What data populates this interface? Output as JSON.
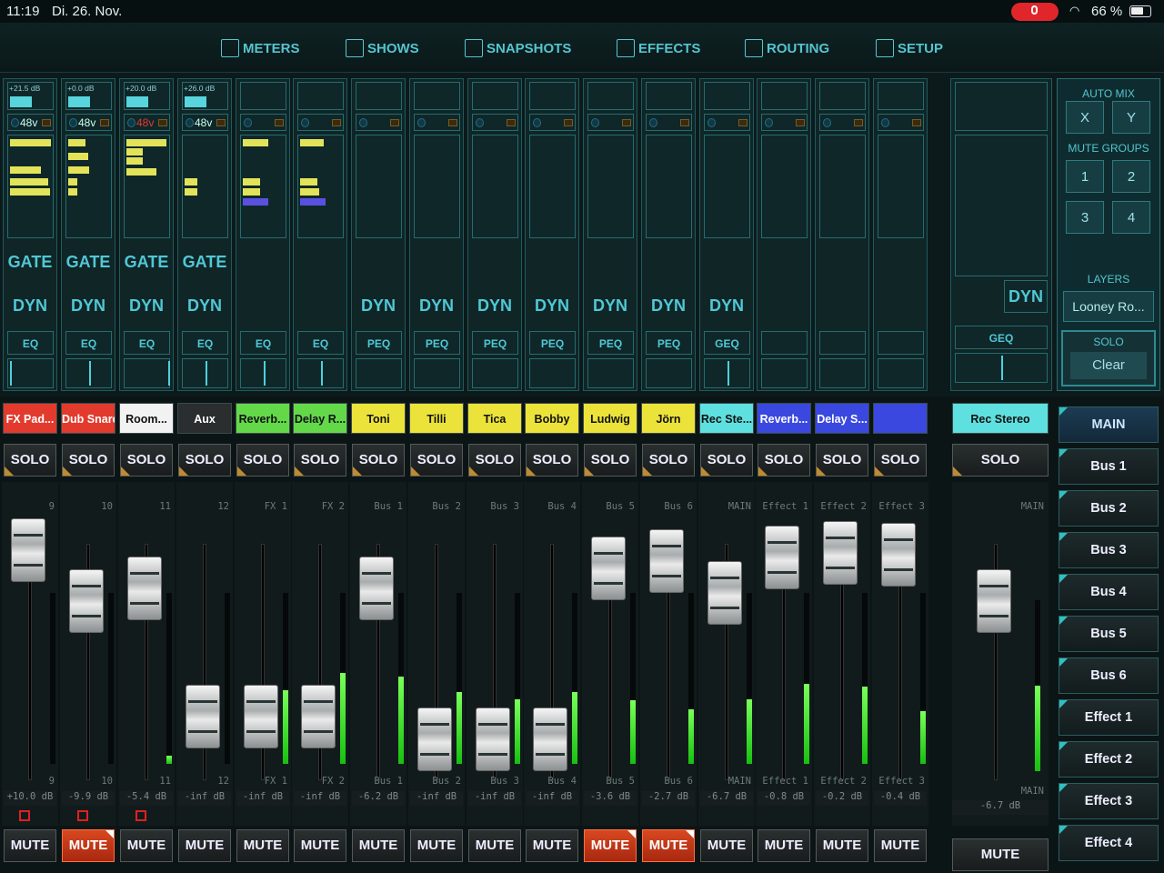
{
  "status": {
    "time": "11:19",
    "date": "Di. 26. Nov.",
    "battery": "66 %",
    "battery_level": 0.66
  },
  "nav": [
    {
      "label": "METERS",
      "icon": "meters-icon"
    },
    {
      "label": "SHOWS",
      "icon": "shows-icon"
    },
    {
      "label": "SNAPSHOTS",
      "icon": "camera-icon"
    },
    {
      "label": "EFFECTS",
      "icon": "effects-icon"
    },
    {
      "label": "ROUTING",
      "icon": "routing-icon"
    },
    {
      "label": "SETUP",
      "icon": "setup-icon"
    }
  ],
  "strips": [
    {
      "gain": "+21.5 dB",
      "phantom": "48v",
      "gate": "GATE",
      "dyn": "DYN",
      "eq": "EQ"
    },
    {
      "gain": "+0.0 dB",
      "phantom": "48v",
      "gate": "GATE",
      "dyn": "DYN",
      "eq": "EQ"
    },
    {
      "gain": "+20.0 dB",
      "phantom": "48v",
      "gate": "GATE",
      "dyn": "DYN",
      "eq": "EQ"
    },
    {
      "gain": "+26.0 dB",
      "phantom": "48v",
      "gate": "GATE",
      "dyn": "DYN",
      "eq": "EQ"
    },
    {
      "eq": "EQ"
    },
    {
      "eq": "EQ"
    },
    {
      "dyn": "DYN",
      "eq": "PEQ"
    },
    {
      "dyn": "DYN",
      "eq": "PEQ"
    },
    {
      "dyn": "DYN",
      "eq": "PEQ"
    },
    {
      "dyn": "DYN",
      "eq": "PEQ"
    },
    {
      "dyn": "DYN",
      "eq": "PEQ"
    },
    {
      "dyn": "DYN",
      "eq": "PEQ"
    },
    {
      "dyn": "DYN",
      "eq": "GEQ"
    },
    {},
    {},
    {}
  ],
  "main_strip": {
    "dyn": "DYN",
    "eq": "GEQ"
  },
  "right_panel": {
    "auto_mix": "AUTO MIX",
    "x": "X",
    "y": "Y",
    "mute_groups": "MUTE GROUPS",
    "groups": [
      "1",
      "2",
      "3",
      "4"
    ],
    "layers": "LAYERS",
    "layer": "Looney Ro...",
    "solo": "SOLO",
    "clear": "Clear"
  },
  "channels": [
    {
      "name": "FX Pad...",
      "color": "#e23b2e",
      "num": "9",
      "out": "9",
      "db": "+10.0 dB",
      "mute": false
    },
    {
      "name": "Dub Snare",
      "color": "#e23b2e",
      "num": "10",
      "out": "10",
      "db": "-9.9 dB",
      "mute": true
    },
    {
      "name": "Room...",
      "color": "#f2f2f2",
      "num": "11",
      "out": "11",
      "db": "-5.4 dB",
      "mute": false
    },
    {
      "name": "Aux",
      "color": "#2a2e2f",
      "num": "12",
      "out": "12",
      "db": "-inf dB",
      "mute": false
    },
    {
      "name": "Reverb...",
      "color": "#63d94a",
      "num": "FX 1",
      "out": "FX 1",
      "db": "-inf dB",
      "mute": false
    },
    {
      "name": "Delay R...",
      "color": "#63d94a",
      "num": "FX 2",
      "out": "FX 2",
      "db": "-inf dB",
      "mute": false
    },
    {
      "name": "Toni",
      "color": "#ece33a",
      "num": "Bus 1",
      "out": "Bus 1",
      "db": "-6.2 dB",
      "mute": false
    },
    {
      "name": "Tilli",
      "color": "#ece33a",
      "num": "Bus 2",
      "out": "Bus 2",
      "db": "-inf dB",
      "mute": false
    },
    {
      "name": "Tica",
      "color": "#ece33a",
      "num": "Bus 3",
      "out": "Bus 3",
      "db": "-inf dB",
      "mute": false
    },
    {
      "name": "Bobby",
      "color": "#ece33a",
      "num": "Bus 4",
      "out": "Bus 4",
      "db": "-inf dB",
      "mute": false
    },
    {
      "name": "Ludwig",
      "color": "#ece33a",
      "num": "Bus 5",
      "out": "Bus 5",
      "db": "-3.6 dB",
      "mute": true
    },
    {
      "name": "Jörn",
      "color": "#ece33a",
      "num": "Bus 6",
      "out": "Bus 6",
      "db": "-2.7 dB",
      "mute": true
    },
    {
      "name": "Rec Ste...",
      "color": "#5fe0e0",
      "num": "MAIN",
      "out": "MAIN",
      "db": "-6.7 dB",
      "mute": false
    },
    {
      "name": "Reverb...",
      "color": "#3a48e0",
      "num": "Effect 1",
      "out": "Effect 1",
      "db": "-0.8 dB",
      "mute": false
    },
    {
      "name": "Delay S...",
      "color": "#3a48e0",
      "num": "Effect 2",
      "out": "Effect 2",
      "db": "-0.2 dB",
      "mute": false
    },
    {
      "name": "",
      "color": "#3a48e0",
      "num": "Effect 3",
      "out": "Effect 3",
      "db": "-0.4 dB",
      "mute": false
    }
  ],
  "fader_levels": [
    0.95,
    0.72,
    0.78,
    0.2,
    0.2,
    0.2,
    0.78,
    0.1,
    0.1,
    0.1,
    0.87,
    0.9,
    0.76,
    0.92,
    0.94,
    0.93
  ],
  "meter_levels": [
    0,
    0,
    0.05,
    0,
    0.43,
    0.53,
    0.51,
    0.42,
    0.38,
    0.42,
    0.37,
    0.32,
    0.38,
    0.47,
    0.45,
    0.31
  ],
  "main": {
    "name": "Rec Stereo",
    "color": "#5fe0e0",
    "solo": "SOLO",
    "num": "MAIN",
    "out": "MAIN",
    "db": "-6.7 dB",
    "mute": "MUTE",
    "fader_level": 0.72,
    "meter_level": 0.5
  },
  "solo_label": "SOLO",
  "mute_label": "MUTE",
  "buses": [
    {
      "label": "MAIN",
      "selected": true
    },
    {
      "label": "Bus 1"
    },
    {
      "label": "Bus 2"
    },
    {
      "label": "Bus 3"
    },
    {
      "label": "Bus 4"
    },
    {
      "label": "Bus 5"
    },
    {
      "label": "Bus 6"
    },
    {
      "label": "Effect 1"
    },
    {
      "label": "Effect 2"
    },
    {
      "label": "Effect 3"
    },
    {
      "label": "Effect 4"
    }
  ],
  "colors": {
    "accent": "#55c5d0",
    "mute_on": "#d84820",
    "meter": "#16c010"
  }
}
